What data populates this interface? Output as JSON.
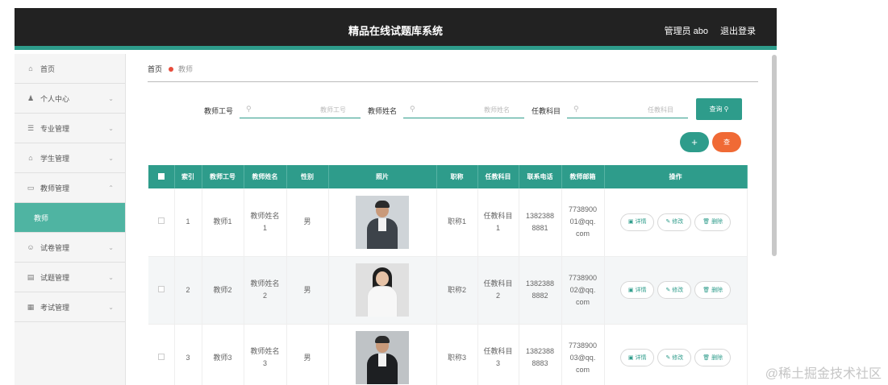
{
  "header": {
    "title": "精品在线试题库系统",
    "admin_label": "管理员 abo",
    "logout_label": "退出登录"
  },
  "sidebar": {
    "items": [
      {
        "label": "首页",
        "icon": "home-icon",
        "glyph": "⌂",
        "chevron": ""
      },
      {
        "label": "个人中心",
        "icon": "user-icon",
        "glyph": "👤",
        "chevron": "⌄"
      },
      {
        "label": "专业管理",
        "icon": "list-icon",
        "glyph": "☰",
        "chevron": "⌄"
      },
      {
        "label": "学生管理",
        "icon": "bank-icon",
        "glyph": "⌂",
        "chevron": "⌄"
      },
      {
        "label": "教师管理",
        "icon": "card-icon",
        "glyph": "▭",
        "chevron": "⌃"
      },
      {
        "label": "教师",
        "icon": "",
        "glyph": "",
        "chevron": ""
      },
      {
        "label": "试卷管理",
        "icon": "smile-icon",
        "glyph": "☺",
        "chevron": "⌄"
      },
      {
        "label": "试题管理",
        "icon": "grid-icon",
        "glyph": "▤",
        "chevron": "⌄"
      },
      {
        "label": "考试管理",
        "icon": "doc-icon",
        "glyph": "▦",
        "chevron": "⌄"
      }
    ]
  },
  "breadcrumb": {
    "home": "首页",
    "current": "教师"
  },
  "search": {
    "fields": [
      {
        "label": "教师工号",
        "placeholder": "教师工号"
      },
      {
        "label": "教师姓名",
        "placeholder": "教师姓名"
      },
      {
        "label": "任教科目",
        "placeholder": "任教科目"
      }
    ],
    "query_label": "查询 ⚲",
    "add_label": "+",
    "delete_label": "查"
  },
  "table": {
    "columns": [
      "索引",
      "教师工号",
      "教师姓名",
      "性别",
      "照片",
      "职称",
      "任教科目",
      "联系电话",
      "教师邮箱",
      "操作"
    ],
    "rows": [
      {
        "index": "1",
        "id": "教师1",
        "name": "教师姓名\n1",
        "gender": "男",
        "title": "职称1",
        "subject": "任教科目\n1",
        "phone": "1382388\n8881",
        "email": "7738900\n01@qq.\ncom"
      },
      {
        "index": "2",
        "id": "教师2",
        "name": "教师姓名\n2",
        "gender": "男",
        "title": "职称2",
        "subject": "任教科目\n2",
        "phone": "1382388\n8882",
        "email": "7738900\n02@qq.\ncom"
      },
      {
        "index": "3",
        "id": "教师3",
        "name": "教师姓名\n3",
        "gender": "男",
        "title": "职称3",
        "subject": "任教科目\n3",
        "phone": "1382388\n8883",
        "email": "7738900\n03@qq.\ncom"
      }
    ],
    "actions": {
      "detail": "▣ 详情",
      "edit": "✎ 修改",
      "delete": "🗑 删除"
    }
  },
  "watermark": "@稀土掘金技术社区",
  "colors": {
    "accent": "#2e9c8b",
    "danger": "#f06a35",
    "header": "#222222",
    "dot": "#e74c3c"
  }
}
